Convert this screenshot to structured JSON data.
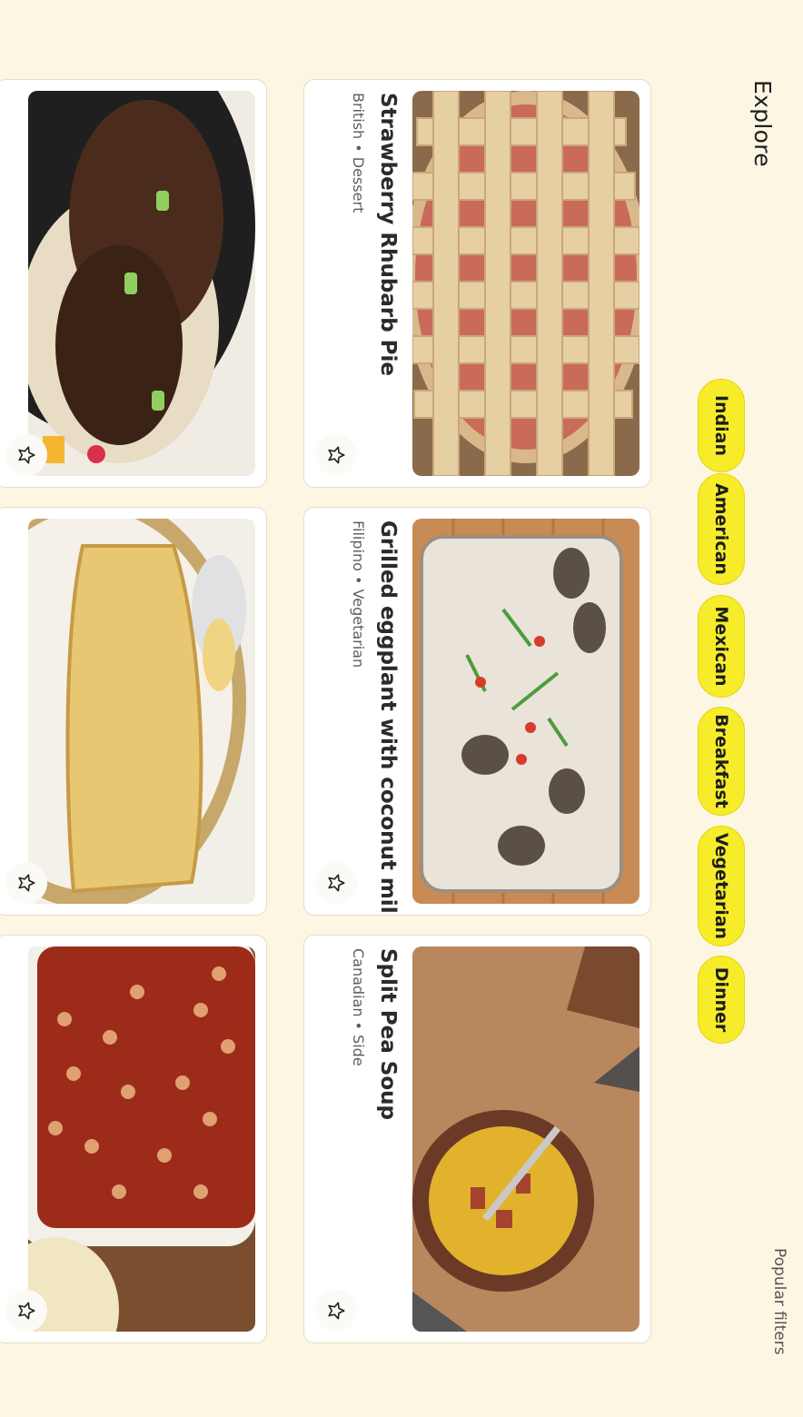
{
  "header": {
    "title": "Explore",
    "popular_filters_label": "Popular filters"
  },
  "filters": [
    {
      "label": "Indian"
    },
    {
      "label": "American"
    },
    {
      "label": "Mexican"
    },
    {
      "label": "Breakfast"
    },
    {
      "label": "Vegetarian"
    },
    {
      "label": "Dinner"
    }
  ],
  "recipes": [
    {
      "title": "Strawberry Rhubarb Pie",
      "meta": "British • Dessert",
      "favorited": false,
      "image": "lattice pie"
    },
    {
      "title": "Grilled eggplant with coconut milk",
      "meta": "Filipino • Vegetarian",
      "favorited": false,
      "image": "eggplant dish"
    },
    {
      "title": "Split Pea Soup",
      "meta": "Canadian • Side",
      "favorited": false,
      "image": "pea soup bowl"
    },
    {
      "title": "",
      "meta": "",
      "favorited": false,
      "image": "grilled chicken"
    },
    {
      "title": "",
      "meta": "",
      "favorited": false,
      "image": "phyllo pastry"
    },
    {
      "title": "",
      "meta": "",
      "favorited": false,
      "image": "baked beans"
    }
  ],
  "colors": {
    "background": "#fdf6e3",
    "chip": "#f7ec2a",
    "card": "#ffffff"
  },
  "icons": {
    "favorite": "star-outline-icon"
  }
}
